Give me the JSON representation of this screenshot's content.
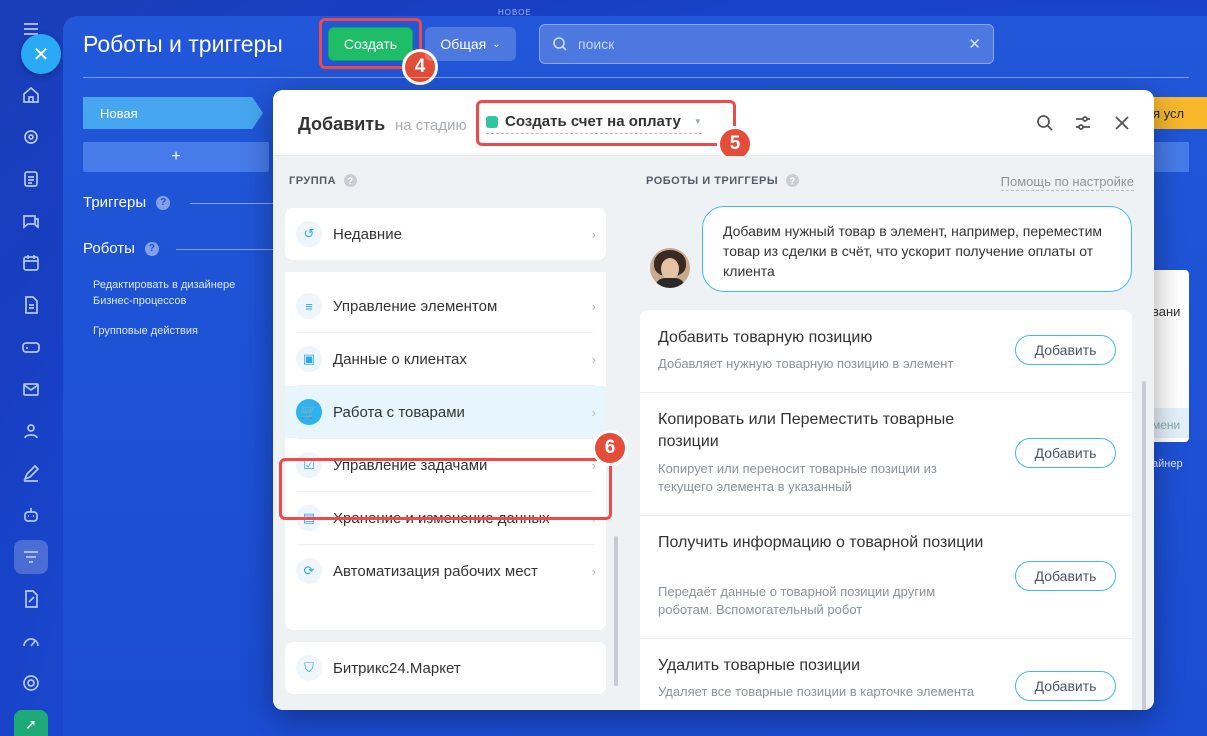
{
  "header": {
    "title": "Роботы и триггеры",
    "new_label": "НОВОЕ",
    "create_label": "Создать",
    "general_label": "Общая",
    "search_placeholder": "поиск"
  },
  "stages": {
    "first": "Новая",
    "add": "+",
    "right_orange": "я усл",
    "right_card_title": "вани",
    "right_card_button": "мени",
    "right_link": "айнер"
  },
  "sections": {
    "triggers": "Триггеры",
    "robots": "Роботы",
    "links": [
      "Редактировать в дизайнере",
      "Бизнес-процессов",
      "Групповые действия"
    ],
    "help_q": "?"
  },
  "modal": {
    "title": "Добавить",
    "on_stage": "на стадию",
    "stage": "Создать счет на оплату",
    "group_header": "ГРУППА",
    "robots_header": "РОБОТЫ И ТРИГГЕРЫ",
    "help_link": "Помощь по настройке",
    "groups": [
      "Недавние",
      "Управление элементом",
      "Данные о клиентах",
      "Работа с товарами",
      "Управление задачами",
      "Хранение и изменение данных",
      "Автоматизация рабочих мест"
    ],
    "market": "Битрикс24.Маркет",
    "bubble": "Добавим нужный товар в элемент, например, переместим товар из сделки в счёт, что ускорит получение оплаты от клиента",
    "items": [
      {
        "name": "Добавить товарную позицию",
        "desc": "Добавляет нужную товарную позицию в элемент",
        "btn": "Добавить"
      },
      {
        "name": "Копировать или Переместить товарные позиции",
        "desc": "Копирует или переносит товарные позиции из текущего элемента в указанный",
        "btn": "Добавить"
      },
      {
        "name": "Получить информацию о товарной позиции",
        "desc": "Передаёт данные о товарной позиции другим роботам. Вспомогательный робот",
        "btn": "Добавить"
      },
      {
        "name": "Удалить товарные позиции",
        "desc": "Удаляет все товарные позиции в карточке элемента",
        "btn": "Добавить"
      }
    ]
  },
  "annotations": {
    "n4": "4",
    "n5": "5",
    "n6": "6"
  },
  "colors": {
    "create": "#1fbd67",
    "highlight": "#ef4a4a",
    "accent": "#3fbaf0"
  }
}
